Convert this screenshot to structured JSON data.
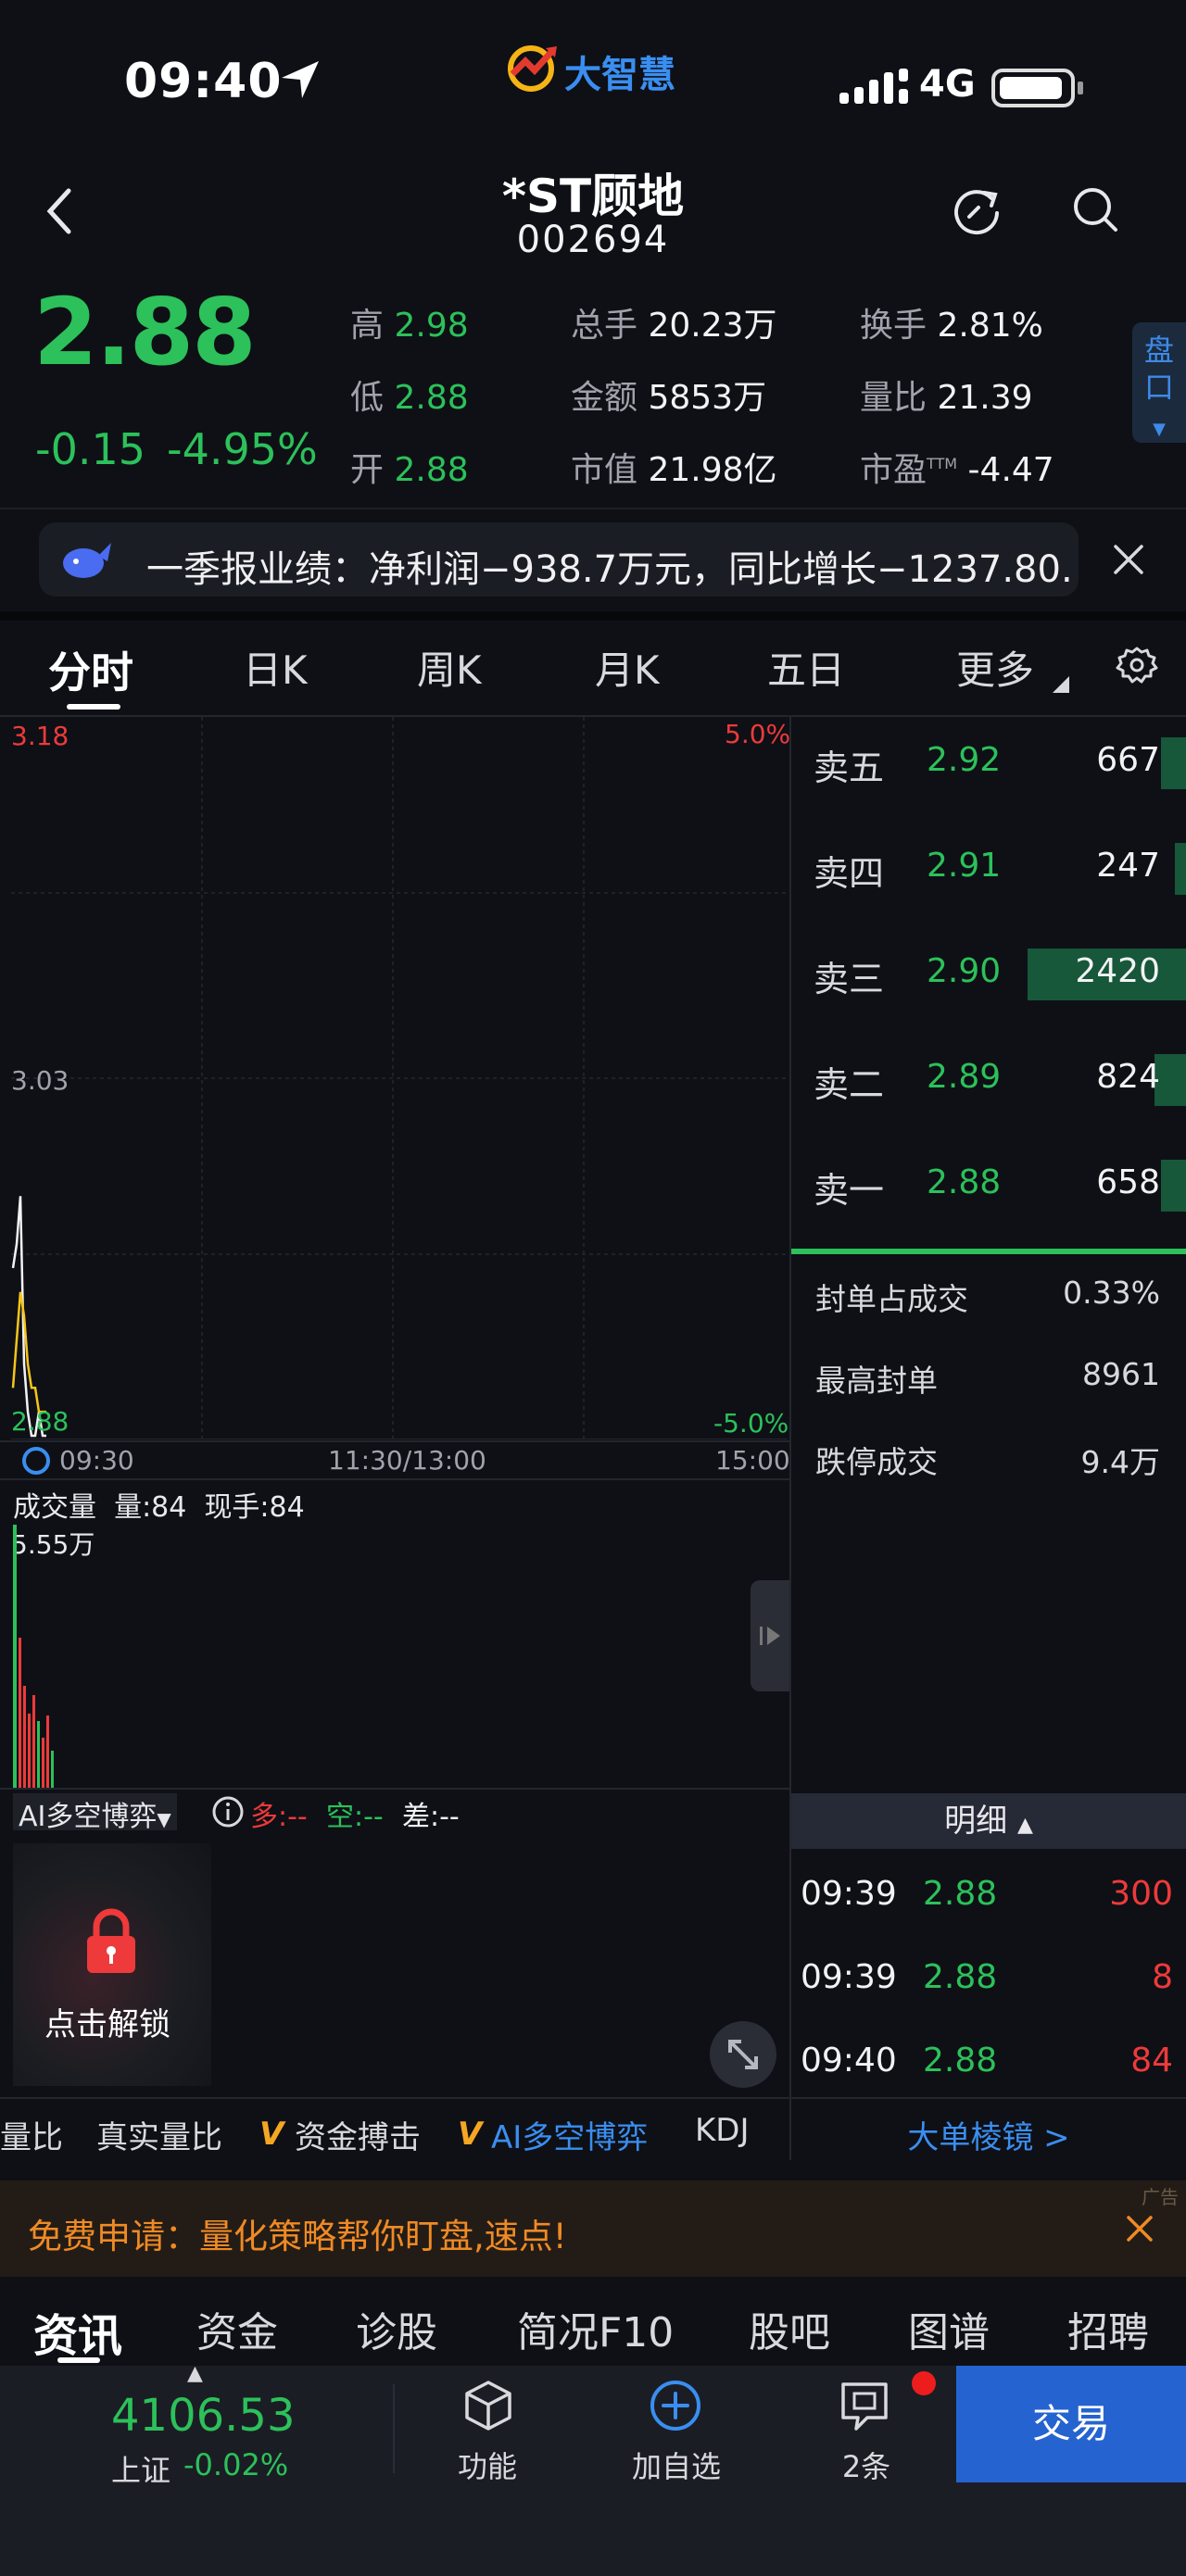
{
  "status_bar": {
    "time": "09:40",
    "brand": "大智慧",
    "network": "4G"
  },
  "header": {
    "title": "*ST顾地",
    "code": "002694"
  },
  "quote": {
    "price": "2.88",
    "change": "-0.15",
    "change_pct": "-4.95%",
    "stats": [
      {
        "label": "高",
        "value": "2.98",
        "color": "#2cc15a"
      },
      {
        "label": "总手",
        "value": "20.23万"
      },
      {
        "label": "换手",
        "value": "2.81%"
      },
      {
        "label": "低",
        "value": "2.88",
        "color": "#2cc15a"
      },
      {
        "label": "金额",
        "value": "5853万"
      },
      {
        "label": "量比",
        "value": "21.39"
      },
      {
        "label": "开",
        "value": "2.88",
        "color": "#2cc15a"
      },
      {
        "label": "市值",
        "value": "21.98亿"
      },
      {
        "label": "市盈",
        "value": "-4.47",
        "sup": "TTM"
      }
    ],
    "side_button": "盘口"
  },
  "notice": {
    "text": "一季报业绩：净利润−938.7万元，同比增长−1237.80..."
  },
  "chart_tabs": [
    "分时",
    "日K",
    "周K",
    "月K",
    "五日",
    "更多"
  ],
  "chart": {
    "y_top": "3.18",
    "y_top_pct": "5.0%",
    "y_mid": "3.03",
    "y_bottom": "2.88",
    "y_bottom_pct": "-5.0%",
    "x_labels": [
      "09:30",
      "11:30/13:00",
      "15:00"
    ],
    "volume_title": "成交量",
    "volume_amount": "量:84",
    "volume_now": "现手:84",
    "volume_max": "5.55万",
    "ai_indicator": "AI多空博弈",
    "ai_long": "多:--",
    "ai_short": "空:--",
    "ai_diff": "差:--",
    "unlock_label": "点击解锁",
    "indicator_tabs": [
      "量比",
      "真实量比",
      "资金搏击",
      "AI多空博弈",
      "KDJ"
    ],
    "ylim": [
      2.88,
      3.18
    ],
    "price_line": [
      2.95,
      2.96,
      2.98,
      2.91,
      2.89,
      2.88,
      2.88,
      2.89,
      2.88,
      2.88
    ],
    "avg_line": [
      2.9,
      2.92,
      2.94,
      2.93,
      2.91,
      2.9,
      2.9,
      2.89,
      2.89,
      2.89
    ]
  },
  "order_book": [
    {
      "label": "卖五",
      "price": "2.92",
      "volume": "667",
      "ratio": 0.14
    },
    {
      "label": "卖四",
      "price": "2.91",
      "volume": "247",
      "ratio": 0.04
    },
    {
      "label": "卖三",
      "price": "2.90",
      "volume": "2420",
      "ratio": 0.9
    },
    {
      "label": "卖二",
      "price": "2.89",
      "volume": "824",
      "ratio": 0.18
    },
    {
      "label": "卖一",
      "price": "2.88",
      "volume": "658",
      "ratio": 0.14
    }
  ],
  "limit_stats": [
    {
      "label": "封单占成交",
      "value": "0.33%"
    },
    {
      "label": "最高封单",
      "value": "8961"
    },
    {
      "label": "跌停成交",
      "value": "9.4万"
    }
  ],
  "detail": {
    "header": "明细",
    "rows": [
      {
        "time": "09:39",
        "price": "2.88",
        "volume": "300"
      },
      {
        "time": "09:39",
        "price": "2.88",
        "volume": "8"
      },
      {
        "time": "09:40",
        "price": "2.88",
        "volume": "84"
      }
    ],
    "link": "大单棱镜 >"
  },
  "ad": {
    "text": "免费申请：量化策略帮你盯盘,速点!",
    "tag": "广告"
  },
  "feature_tabs": [
    "资讯",
    "资金",
    "诊股",
    "简况F10",
    "股吧",
    "图谱",
    "招聘"
  ],
  "bottom_bar": {
    "index_value": "4106.53",
    "index_name": "上证",
    "index_change": "-0.02%",
    "buttons": [
      "功能",
      "加自选",
      "2条"
    ],
    "trade": "交易"
  },
  "colors": {
    "green": "#2cc15a",
    "red": "#ee3a3a",
    "blue": "#2563d0",
    "background": "#0e1016"
  }
}
